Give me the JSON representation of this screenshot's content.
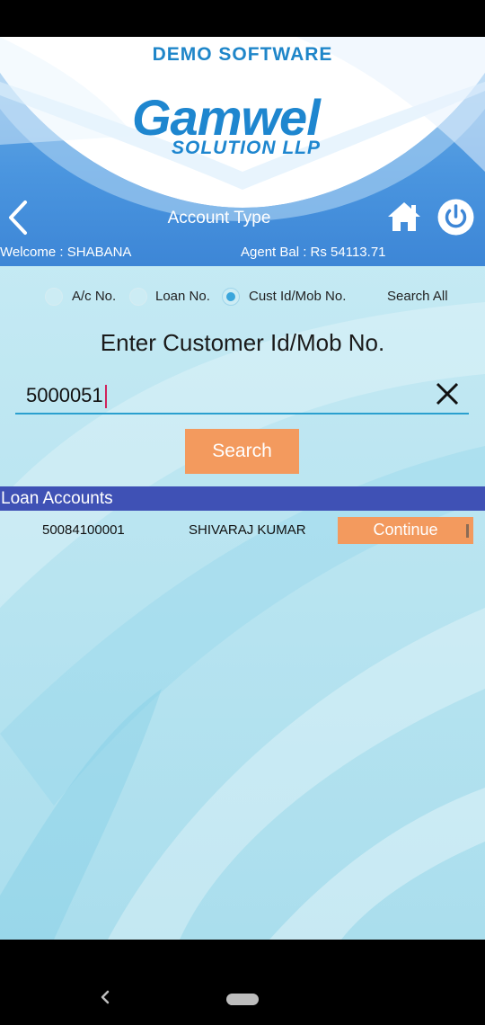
{
  "header": {
    "banner_text": "DEMO SOFTWARE",
    "logo_main": "Gamwel",
    "logo_sub": "SOLUTION LLP",
    "title": "Account Type",
    "back_icon": "chevron-left-icon",
    "home_icon": "home-icon",
    "power_icon": "power-icon"
  },
  "user": {
    "welcome": "Welcome :  SHABANA",
    "agent_balance": "Agent Bal : Rs 54113.71"
  },
  "search_type": {
    "options": [
      {
        "label": "A/c No.",
        "selected": false
      },
      {
        "label": "Loan No.",
        "selected": false
      },
      {
        "label": "Cust Id/Mob No.",
        "selected": true
      },
      {
        "label": "Search All",
        "selected": false
      }
    ]
  },
  "form": {
    "prompt": "Enter Customer Id/Mob No.",
    "input_value": "5000051",
    "clear_icon": "close-icon",
    "search_label": "Search"
  },
  "results": {
    "section_title": "Loan Accounts",
    "rows": [
      {
        "account": "50084100001",
        "name": "SHIVARAJ KUMAR",
        "action": "Continue"
      }
    ]
  },
  "colors": {
    "header_blue": "#3d86d6",
    "logo_blue": "#1e86cf",
    "accent_orange": "#f39a5e",
    "section_bar": "#3f51b5",
    "radio_checked": "#3aa6dc"
  }
}
